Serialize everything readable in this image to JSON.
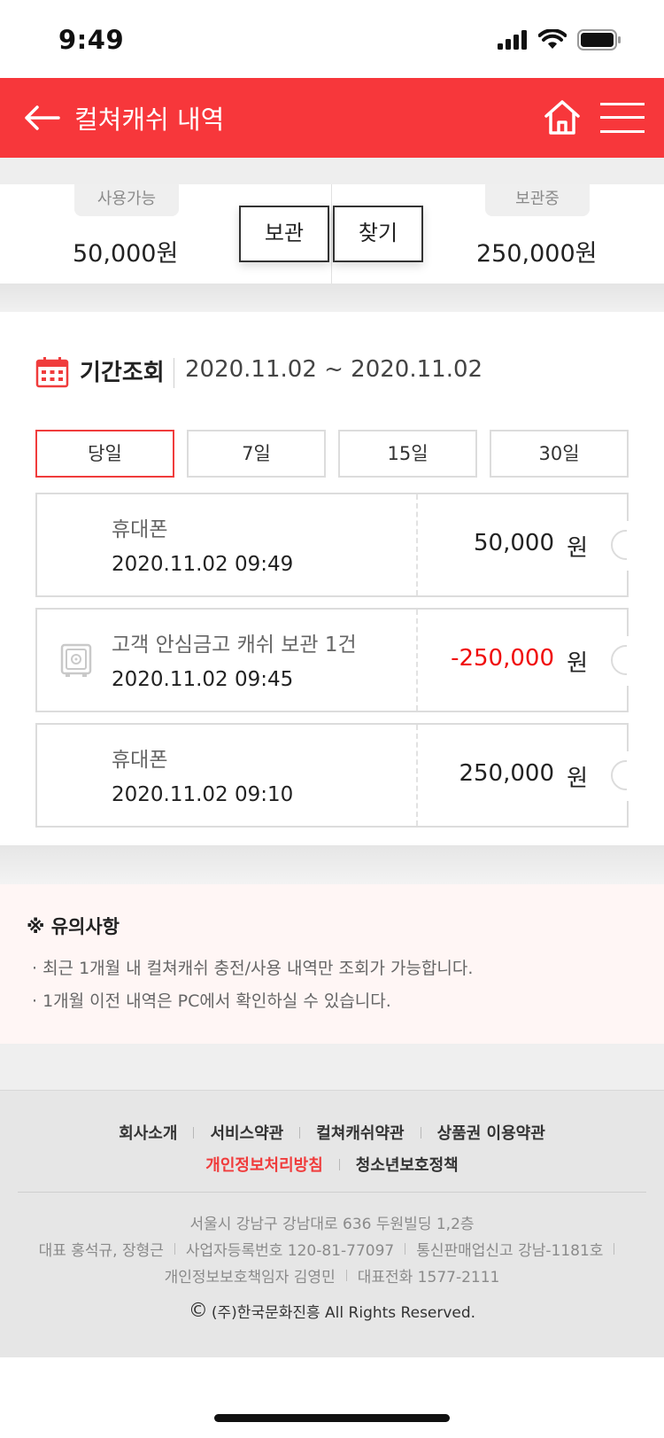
{
  "status_bar": {
    "time": "9:49"
  },
  "header": {
    "title": "컬쳐캐쉬 내역"
  },
  "summary": {
    "available_label": "사용가능",
    "available_amount": "50,000원",
    "stored_label": "보관중",
    "stored_amount": "250,000원",
    "store_button": "보관",
    "find_button": "찾기"
  },
  "period": {
    "label": "기간조회",
    "range": "2020.11.02 ~ 2020.11.02",
    "tabs": [
      "당일",
      "7일",
      "15일",
      "30일"
    ],
    "active_tab": "당일"
  },
  "records": [
    {
      "title": "휴대폰",
      "time": "2020.11.02 09:49",
      "amount": "50,000",
      "unit": "원",
      "negative": false,
      "icon": ""
    },
    {
      "title": "고객 안심금고 캐쉬 보관 1건",
      "time": "2020.11.02 09:45",
      "amount": "-250,000",
      "unit": "원",
      "negative": true,
      "icon": "safe-icon"
    },
    {
      "title": "휴대폰",
      "time": "2020.11.02 09:10",
      "amount": "250,000",
      "unit": "원",
      "negative": false,
      "icon": ""
    }
  ],
  "notice": {
    "title": "※ 유의사항",
    "items": [
      "· 최근 1개월 내 컬쳐캐쉬 충전/사용 내역만 조회가 가능합니다.",
      "· 1개월 이전 내역은 PC에서 확인하실 수 있습니다."
    ]
  },
  "footer": {
    "links_row1": [
      "회사소개",
      "서비스약관",
      "컬쳐캐쉬약관",
      "상품권 이용약관"
    ],
    "links_row2": [
      "개인정보처리방침",
      "청소년보호정책"
    ],
    "address": "서울시 강남구 강남대로 636 두원빌딩 1,2층",
    "info_row2": [
      "대표 홍석규, 장형근",
      "사업자등록번호 120-81-77097",
      "통신판매업신고 강남-1181호"
    ],
    "info_row3": [
      "개인정보보호책임자 김영민",
      "대표전화 1577-2111"
    ],
    "copyright": "(주)한국문화진흥 All Rights Reserved.",
    "copyright_symbol": "©"
  },
  "colors": {
    "brand_red": "#f7373b",
    "negative_red": "#f00a0a",
    "notice_bg": "#fff6f5"
  }
}
